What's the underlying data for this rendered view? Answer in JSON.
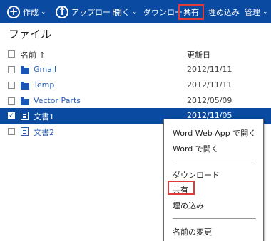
{
  "toolbar": {
    "create": "作成",
    "upload": "アップロード",
    "open": "開く",
    "download": "ダウンロード",
    "share": "共有",
    "embed": "埋め込み",
    "manage": "管理"
  },
  "page_title": "ファイル",
  "list": {
    "col_name": "名前 ↑",
    "col_date": "更新日",
    "rows": [
      {
        "name": "Gmail",
        "date": "2012/11/11",
        "type": "folder",
        "selected": false
      },
      {
        "name": "Temp",
        "date": "2012/11/11",
        "type": "folder",
        "selected": false
      },
      {
        "name": "Vector Parts",
        "date": "2012/05/09",
        "type": "folder",
        "selected": false
      },
      {
        "name": "文書1",
        "date": "2012/11/05",
        "type": "document",
        "selected": true
      },
      {
        "name": "文書2",
        "date": "",
        "type": "document",
        "selected": false
      }
    ]
  },
  "context_menu": {
    "open_web_app": "Word Web App で開く",
    "open_word": "Word で開く",
    "download": "ダウンロード",
    "share": "共有",
    "embed": "埋め込み",
    "rename": "名前の変更"
  },
  "colors": {
    "toolbar_bg": "#0a4aa0",
    "highlight": "#e03a3a",
    "link": "#2a5db0"
  }
}
